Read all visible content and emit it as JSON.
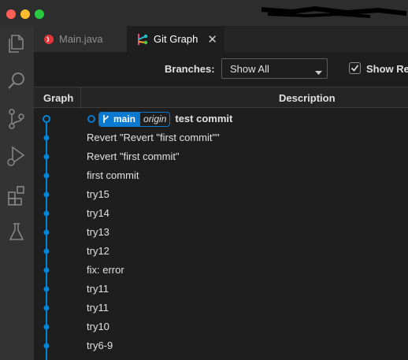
{
  "window": {
    "traffic_lights": [
      "#ff5f57",
      "#febc2e",
      "#28c840"
    ]
  },
  "activity_bar": {
    "icons": [
      "explorer-icon",
      "search-icon",
      "source-control-icon",
      "run-debug-icon",
      "extensions-icon",
      "testing-icon"
    ]
  },
  "tabs": [
    {
      "label": "Main.java",
      "icon": "java-icon"
    },
    {
      "label": "Git Graph",
      "icon": "git-graph-icon"
    }
  ],
  "controls": {
    "branches_label": "Branches:",
    "branches_value": "Show All",
    "show_remote_label": "Show Re",
    "show_remote_checked": true
  },
  "table": {
    "headers": {
      "graph": "Graph",
      "description": "Description"
    },
    "head_refs": {
      "branch": "main",
      "remote": "origin"
    },
    "commits": [
      {
        "message": "test commit"
      },
      {
        "message": "Revert \"Revert \"first commit\"\""
      },
      {
        "message": "Revert \"first commit\""
      },
      {
        "message": "first commit"
      },
      {
        "message": "try15"
      },
      {
        "message": "try14"
      },
      {
        "message": "try13"
      },
      {
        "message": "try12"
      },
      {
        "message": "fix: error"
      },
      {
        "message": "try11"
      },
      {
        "message": "try11"
      },
      {
        "message": "try10"
      },
      {
        "message": "try6-9"
      }
    ]
  },
  "colors": {
    "accent": "#0b79d0",
    "graph_line": "#0085d9"
  }
}
